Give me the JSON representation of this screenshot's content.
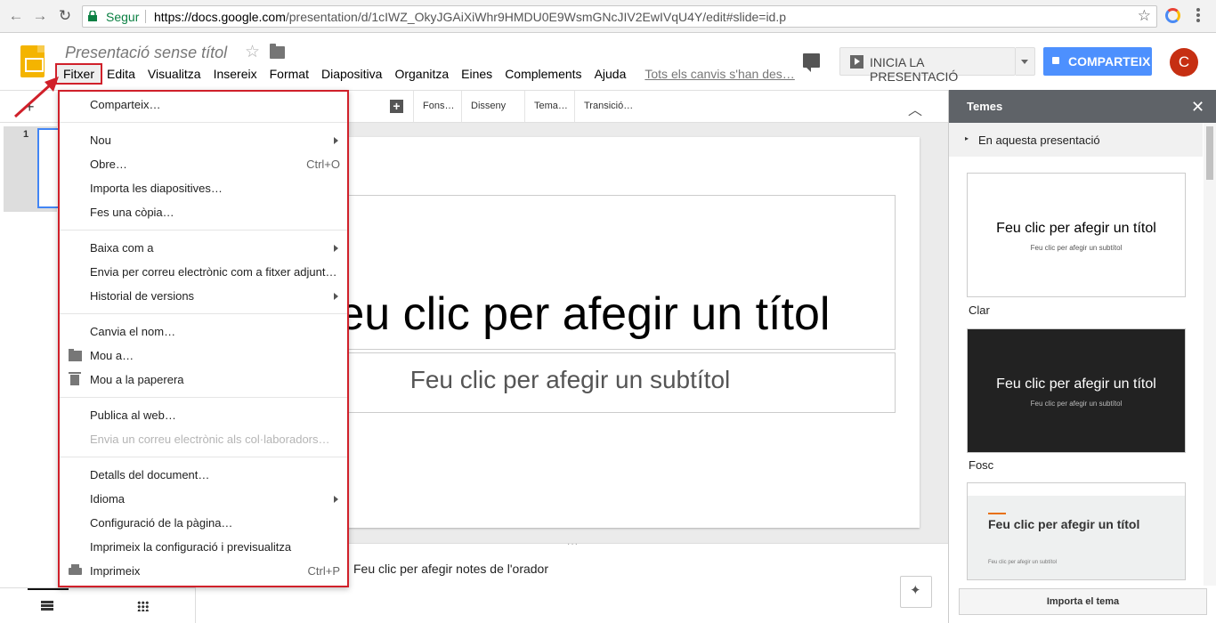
{
  "browser": {
    "secure_label": "Segur",
    "url_host": "https://docs.google.com",
    "url_path": "/presentation/d/1cIWZ_OkyJGAiXiWhr9HMDU0E9WsmGNcJIV2EwIVqU4Y/edit#slide=id.p"
  },
  "header": {
    "doc_title": "Presentació sense títol",
    "present_label": "INICIA LA PRESENTACIÓ",
    "share_label": "COMPARTEIX",
    "avatar_letter": "C"
  },
  "menubar": {
    "items": [
      "Fitxer",
      "Edita",
      "Visualitza",
      "Insereix",
      "Format",
      "Diapositiva",
      "Organitza",
      "Eines",
      "Complements",
      "Ajuda"
    ],
    "save_status": "Tots els canvis s'han des…"
  },
  "toolbar": {
    "background": "Fons…",
    "layout": "Disseny",
    "theme": "Tema…",
    "transition": "Transició…"
  },
  "filmstrip": {
    "slide_number": "1"
  },
  "slide": {
    "title": "Feu clic per afegir un títol",
    "subtitle": "Feu clic per afegir un subtítol"
  },
  "notes": {
    "placeholder": "Feu clic per afegir notes de l'orador"
  },
  "themes_panel": {
    "title": "Temes",
    "section": "En aquesta presentació",
    "cards": [
      {
        "title": "Feu clic per afegir un títol",
        "subtitle": "Feu clic per afegir un subtítol",
        "name": "Clar"
      },
      {
        "title": "Feu clic per afegir un títol",
        "subtitle": "Feu clic per afegir un subtítol",
        "name": "Fosc"
      },
      {
        "title": "Feu clic per afegir un títol",
        "subtitle": "Feu clic per afegir un subtítol",
        "name": ""
      }
    ],
    "import_label": "Importa el tema"
  },
  "file_menu": {
    "share": "Comparteix…",
    "new": "Nou",
    "open": "Obre…",
    "open_shortcut": "Ctrl+O",
    "import_slides": "Importa les diapositives…",
    "make_copy": "Fes una còpia…",
    "download_as": "Baixa com a",
    "email_attachment": "Envia per correu electrònic com a fitxer adjunt…",
    "version_history": "Historial de versions",
    "rename": "Canvia el nom…",
    "move_to": "Mou a…",
    "move_to_trash": "Mou a la paperera",
    "publish_web": "Publica al web…",
    "email_collaborators": "Envia un correu electrònic als col·laboradors…",
    "document_details": "Detalls del document…",
    "language": "Idioma",
    "page_setup": "Configuració de la pàgina…",
    "print_settings": "Imprimeix la configuració i previsualitza",
    "print": "Imprimeix",
    "print_shortcut": "Ctrl+P"
  },
  "colors": {
    "accent_blue": "#4d90fe",
    "annotation_red": "#d0202a",
    "slides_yellow": "#f4b400",
    "avatar_red": "#c62f12"
  }
}
